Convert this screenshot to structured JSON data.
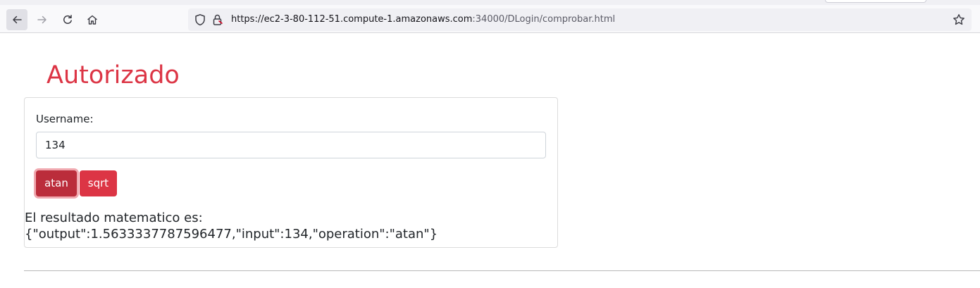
{
  "browser": {
    "url_main": "https://ec2-3-80-112-51.compute-1.amazonaws.com",
    "url_rest": ":34000/DLogin/comprobar.html"
  },
  "page": {
    "title": "Autorizado"
  },
  "form": {
    "username_label": "Username:",
    "username_value": "134",
    "atan_label": "atan",
    "sqrt_label": "sqrt"
  },
  "result": {
    "label": "El resultado matematico es:",
    "value": "{\"output\":1.5633337787596477,\"input\":134,\"operation\":\"atan\"}"
  },
  "colors": {
    "accent": "#dc3545",
    "accent_active": "#bb2d3b"
  },
  "icons": [
    "back-arrow-icon",
    "forward-arrow-icon",
    "reload-icon",
    "home-icon",
    "shield-icon",
    "lock-icon",
    "bookmark-star-icon"
  ]
}
